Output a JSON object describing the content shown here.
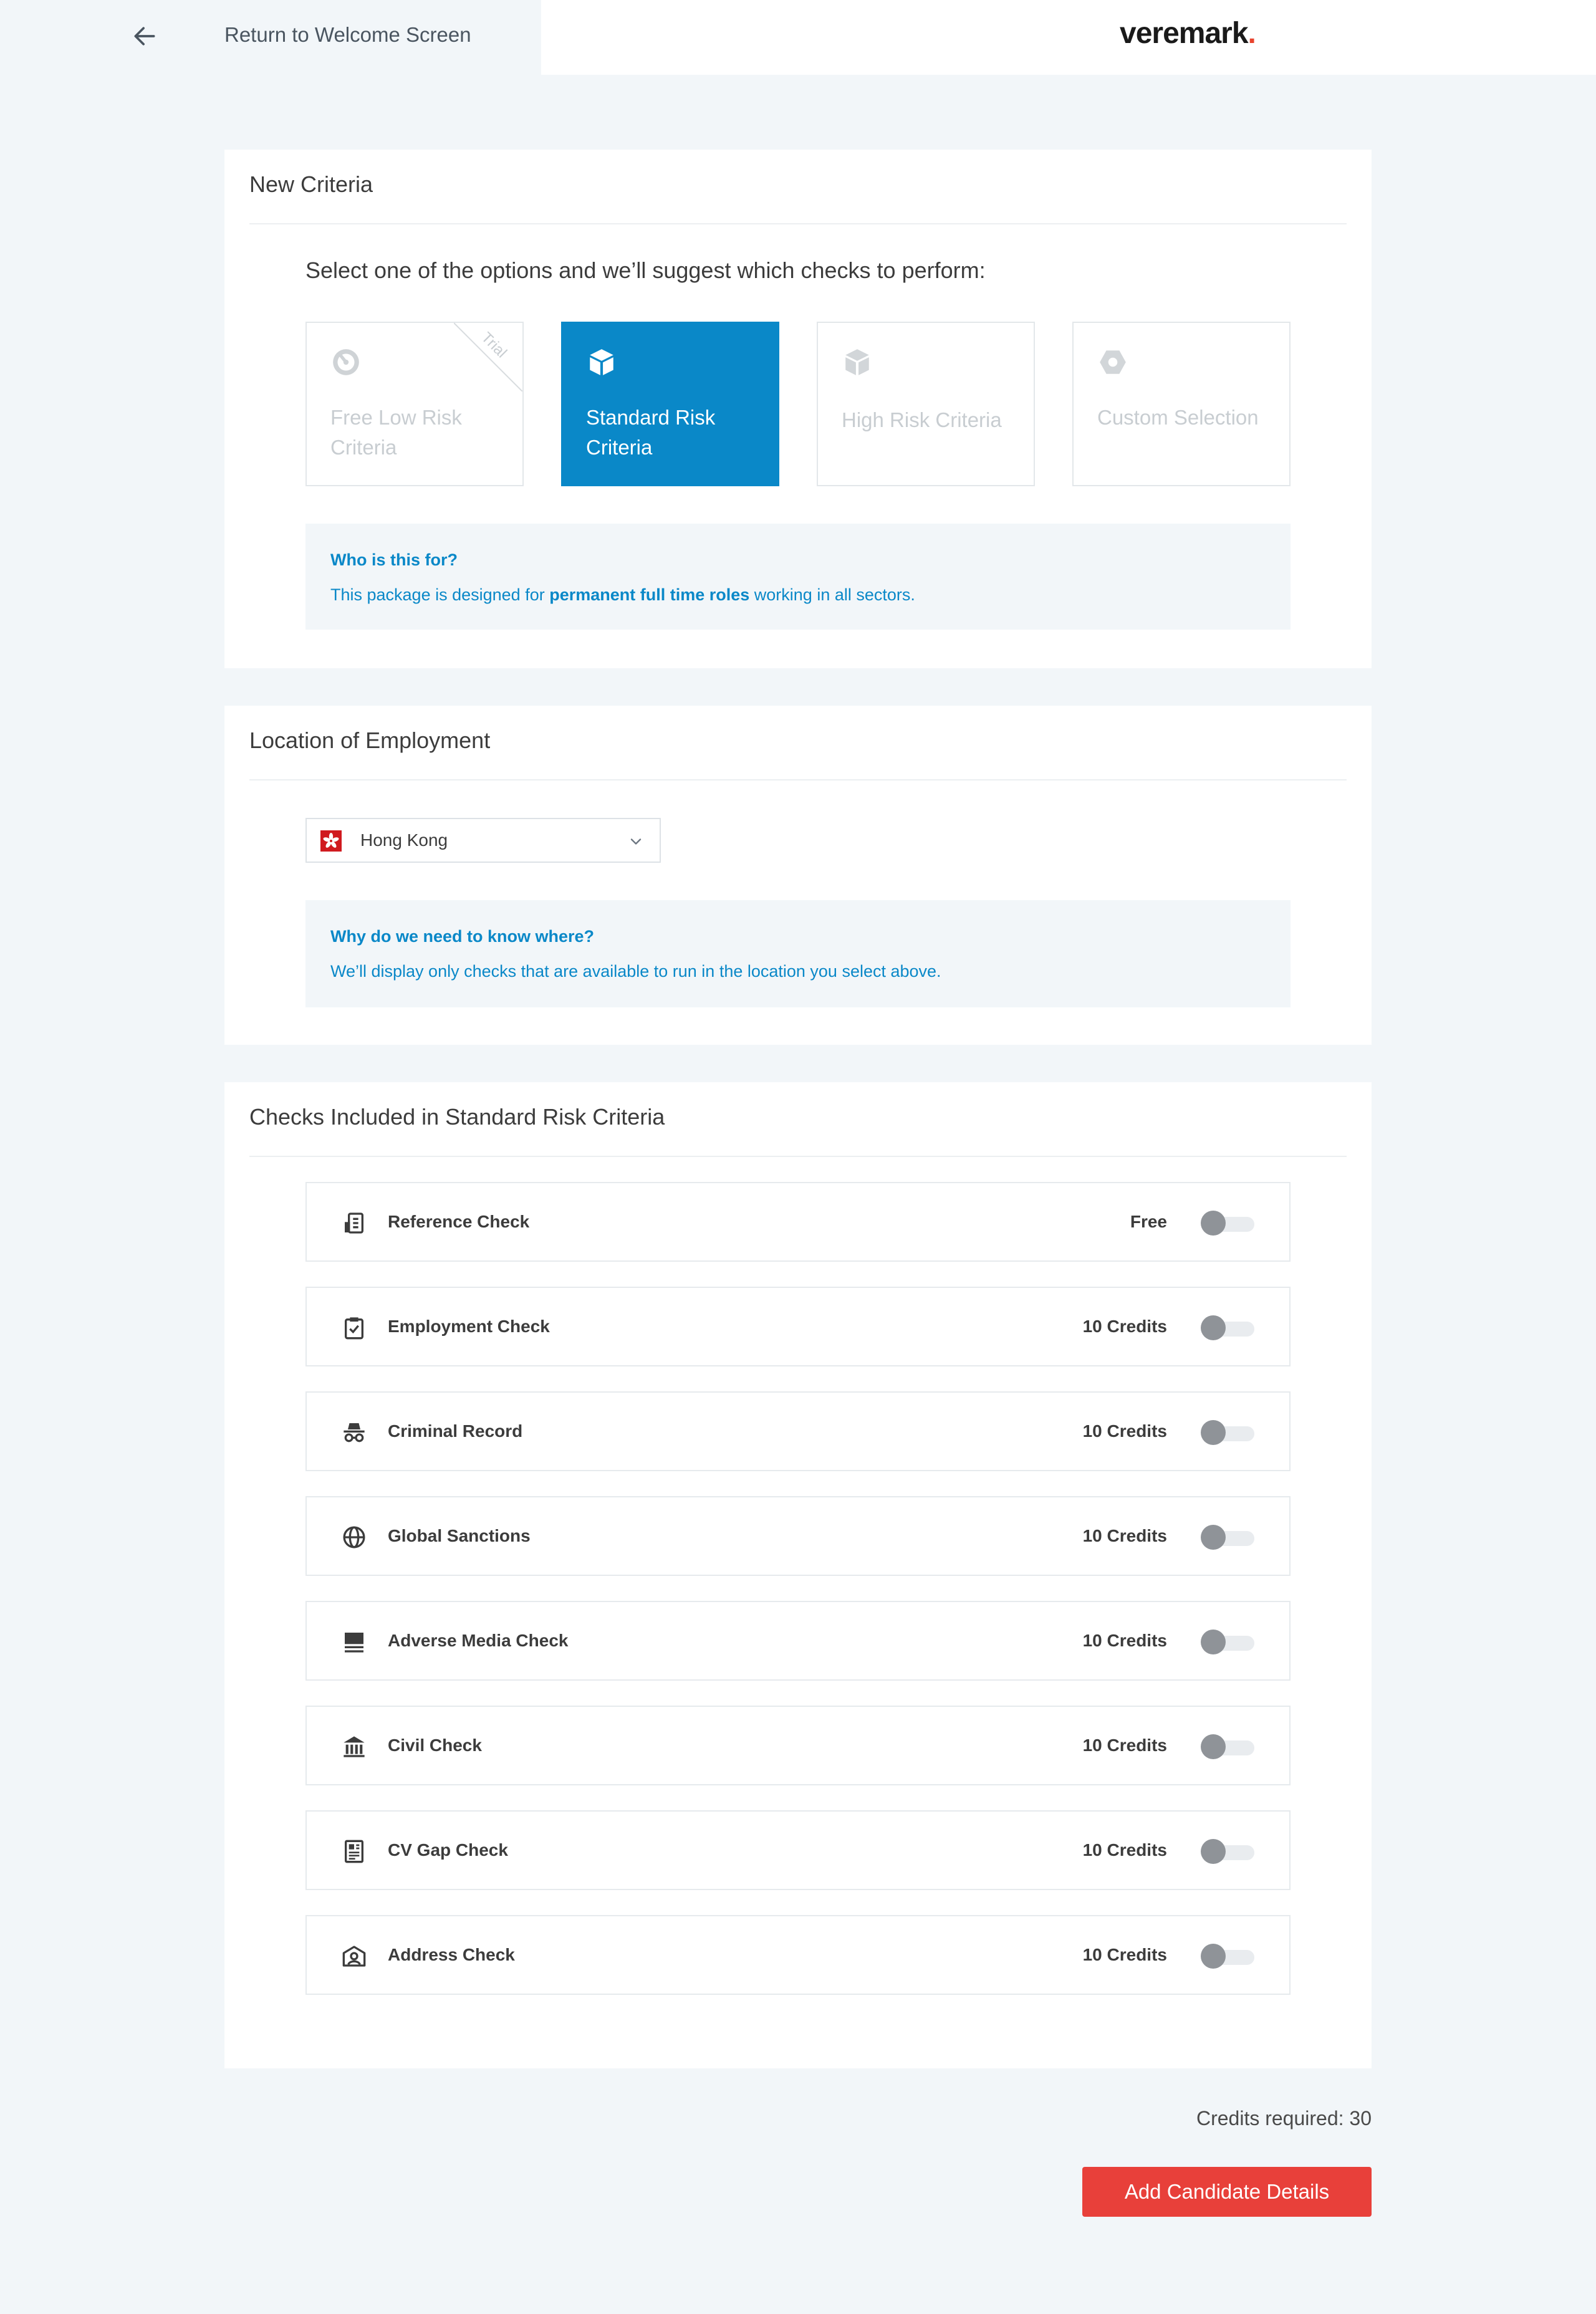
{
  "header": {
    "back_label": "Return to Welcome Screen",
    "brand": "veremark",
    "brand_dot": "."
  },
  "criteria": {
    "title": "New Criteria",
    "prompt": "Select one of the options and we’ll suggest which checks to perform:",
    "options": [
      {
        "label": "Free Low Risk Criteria",
        "badge": "Trial",
        "selected": false,
        "icon": "gauge-icon"
      },
      {
        "label": "Standard Risk Criteria",
        "selected": true,
        "icon": "cube-icon"
      },
      {
        "label": "High Risk Criteria",
        "selected": false,
        "icon": "cube-icon"
      },
      {
        "label": "Custom Selection",
        "selected": false,
        "icon": "hexagon-icon"
      }
    ],
    "info_title": "Who is this for?",
    "info_text_before": "This package is designed for ",
    "info_text_bold": "permanent full time roles",
    "info_text_after": " working in all sectors."
  },
  "location": {
    "title": "Location of Employment",
    "selected_country": "Hong Kong",
    "flag_color": "#d01a1f",
    "info_title": "Why do we need to know where?",
    "info_text": "We’ll display only checks that are available to run in the location you select above."
  },
  "checks": {
    "title": "Checks Included in Standard Risk Criteria",
    "items": [
      {
        "name": "Reference Check",
        "price": "Free",
        "icon": "reference-icon",
        "enabled": false
      },
      {
        "name": "Employment Check",
        "price": "10 Credits",
        "icon": "clipboard-check-icon",
        "enabled": false
      },
      {
        "name": "Criminal Record",
        "price": "10 Credits",
        "icon": "incognito-icon",
        "enabled": false
      },
      {
        "name": "Global Sanctions",
        "price": "10 Credits",
        "icon": "globe-icon",
        "enabled": false
      },
      {
        "name": "Adverse Media Check",
        "price": "10 Credits",
        "icon": "newspaper-icon",
        "enabled": false
      },
      {
        "name": "Civil Check",
        "price": "10 Credits",
        "icon": "bank-icon",
        "enabled": false
      },
      {
        "name": "CV Gap Check",
        "price": "10 Credits",
        "icon": "document-icon",
        "enabled": false
      },
      {
        "name": "Address Check",
        "price": "10 Credits",
        "icon": "address-icon",
        "enabled": false
      }
    ]
  },
  "footer": {
    "credits_text": "Credits required: 30",
    "cta_label": "Add Candidate Details"
  },
  "colors": {
    "accent": "#0a88c8",
    "cta": "#e8403a",
    "background": "#f2f6f9"
  }
}
